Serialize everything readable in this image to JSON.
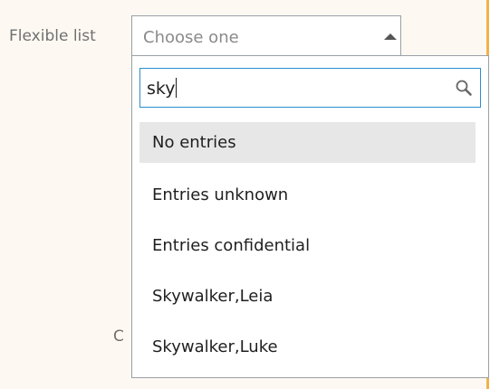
{
  "colors": {
    "panel_background": "#fdf9f2",
    "accent_edge": "#f3b14a",
    "search_focus_border": "#2a8fd0",
    "highlight_background": "#e7e7e7"
  },
  "field": {
    "label": "Flexible list",
    "placeholder": "Choose one",
    "caret_icon": "caret-up-icon"
  },
  "background_text": {
    "partial_label": "C"
  },
  "dropdown": {
    "search": {
      "value": "sky",
      "icon": "search-icon"
    },
    "options": [
      {
        "label": "No entries",
        "highlighted": true
      },
      {
        "label": "Entries unknown",
        "highlighted": false
      },
      {
        "label": "Entries confidential",
        "highlighted": false
      },
      {
        "label": "Skywalker,Leia",
        "highlighted": false
      },
      {
        "label": "Skywalker,Luke",
        "highlighted": false
      }
    ]
  }
}
